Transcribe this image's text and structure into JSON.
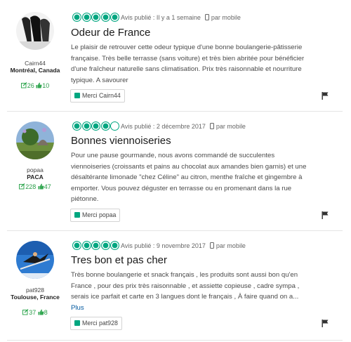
{
  "colors": {
    "rating_green": "#00a680",
    "link_blue": "#00589f",
    "stats_green": "#34a853"
  },
  "icons": {
    "phone": "mobile-phone-icon",
    "thumb": "thumbs-up-icon",
    "flag": "flag-icon",
    "reviews": "review-count-icon",
    "votes": "helpful-votes-icon"
  },
  "reviews": [
    {
      "user": {
        "name": "Cairn44",
        "location": "Montréal, Canada",
        "reviews": "26",
        "votes": "10"
      },
      "rating": 5,
      "published": "Avis publié : Il y a 1 semaine",
      "device": "par mobile",
      "title": "Odeur de France",
      "text": "Le plaisir de retrouver cette odeur typique d'une bonne boulangerie-pâtisserie française. Très belle terrasse (sans voiture) et très bien abritée pour bénéficier d'une fraîcheur naturelle sans climatisation. Prix très raisonnable et nourriture typique. A savourer",
      "more": "",
      "thanks": "Merci Cairn44"
    },
    {
      "user": {
        "name": "popaa",
        "location": "PACA",
        "reviews": "228",
        "votes": "47"
      },
      "rating": 4,
      "published": "Avis publié : 2 décembre 2017",
      "device": "par mobile",
      "title": "Bonnes viennoiseries",
      "text": "Pour une pause gourmande, nous avons commandé de succulentes viennoiseries (croissants et pains au chocolat aux amandes bien garnis) et une désaltérante limonade \"chez Céline\" au citron, menthe fraîche et gingembre à emporter. Vous pouvez déguster en terrasse ou en promenant dans la rue piétonne.",
      "more": "",
      "thanks": "Merci popaa"
    },
    {
      "user": {
        "name": "pat928",
        "location": "Toulouse, France",
        "reviews": "37",
        "votes": "8"
      },
      "rating": 5,
      "published": "Avis publié : 9 novembre 2017",
      "device": "par mobile",
      "title": "Tres bon et pas cher",
      "text": "Très bonne boulangerie et snack français , les produits sont aussi bon qu'en France , pour des prix très raisonnable , et assiette copieuse , cadre sympa , serais ice parfait et carte en 3 langues dont le français , À faire quand on a...",
      "more": "Plus",
      "thanks": "Merci pat928"
    }
  ]
}
